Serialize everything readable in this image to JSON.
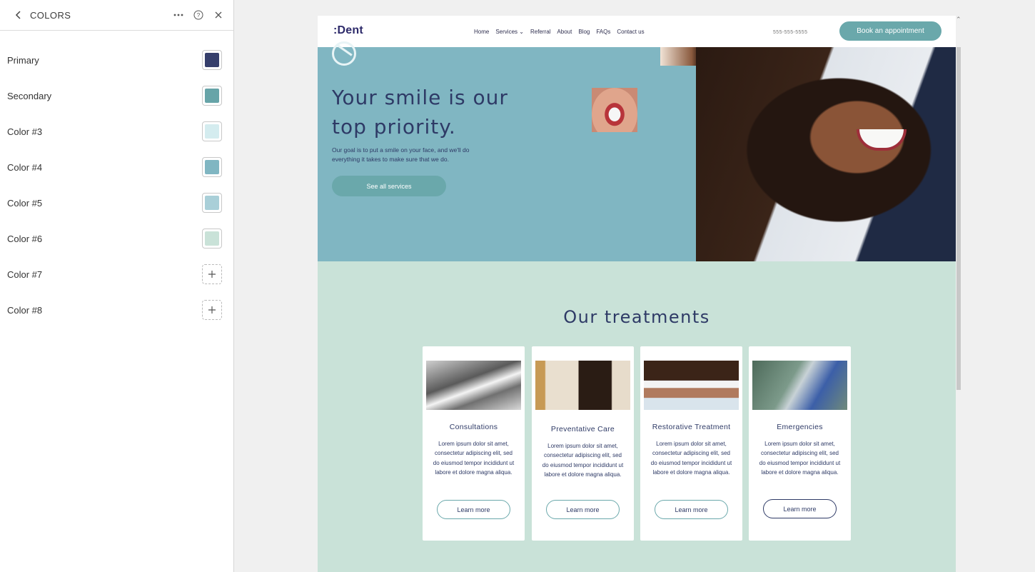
{
  "panel": {
    "title": "COLORS",
    "colors": [
      {
        "label": "Primary",
        "value": "#353e6b"
      },
      {
        "label": "Secondary",
        "value": "#67a4a8"
      },
      {
        "label": "Color #3",
        "value": "#d4ecef"
      },
      {
        "label": "Color #4",
        "value": "#80b6c2"
      },
      {
        "label": "Color #5",
        "value": "#a9cfd8"
      },
      {
        "label": "Color #6",
        "value": "#c9e2d8"
      },
      {
        "label": "Color #7",
        "value": null
      },
      {
        "label": "Color #8",
        "value": null
      }
    ]
  },
  "site": {
    "logo": ":Dent",
    "nav": [
      "Home",
      "Services",
      "Referral",
      "About",
      "Blog",
      "FAQs",
      "Contact us"
    ],
    "services_caret": "⌄",
    "phone": "555-555-5555",
    "book_label": "Book an appointment",
    "hero": {
      "title": "Your smile is our top priority.",
      "text": "Our goal is to put a smile on your face, and we'll do everything it takes to make sure that we do.",
      "button": "See all services"
    },
    "treatments": {
      "title": "Our treatments",
      "cards": [
        {
          "title": "Consultations",
          "text": "Lorem ipsum dolor sit amet, consectetur adipiscing elit, sed do eiusmod tempor incididunt ut labore et dolore magna aliqua.",
          "button": "Learn more"
        },
        {
          "title": "Preventative Care",
          "text": "Lorem ipsum dolor sit amet, consectetur adipiscing elit, sed do eiusmod tempor incididunt ut labore et dolore magna aliqua.",
          "button": "Learn more"
        },
        {
          "title": "Restorative Treatment",
          "text": "Lorem ipsum dolor sit amet, consectetur adipiscing elit, sed do eiusmod tempor incididunt ut labore et dolore magna aliqua.",
          "button": "Learn more"
        },
        {
          "title": "Emergencies",
          "text": "Lorem ipsum dolor sit amet, consectetur adipiscing elit, sed do eiusmod tempor incididunt ut labore et dolore magna aliqua.",
          "button": "Learn more"
        }
      ]
    }
  }
}
